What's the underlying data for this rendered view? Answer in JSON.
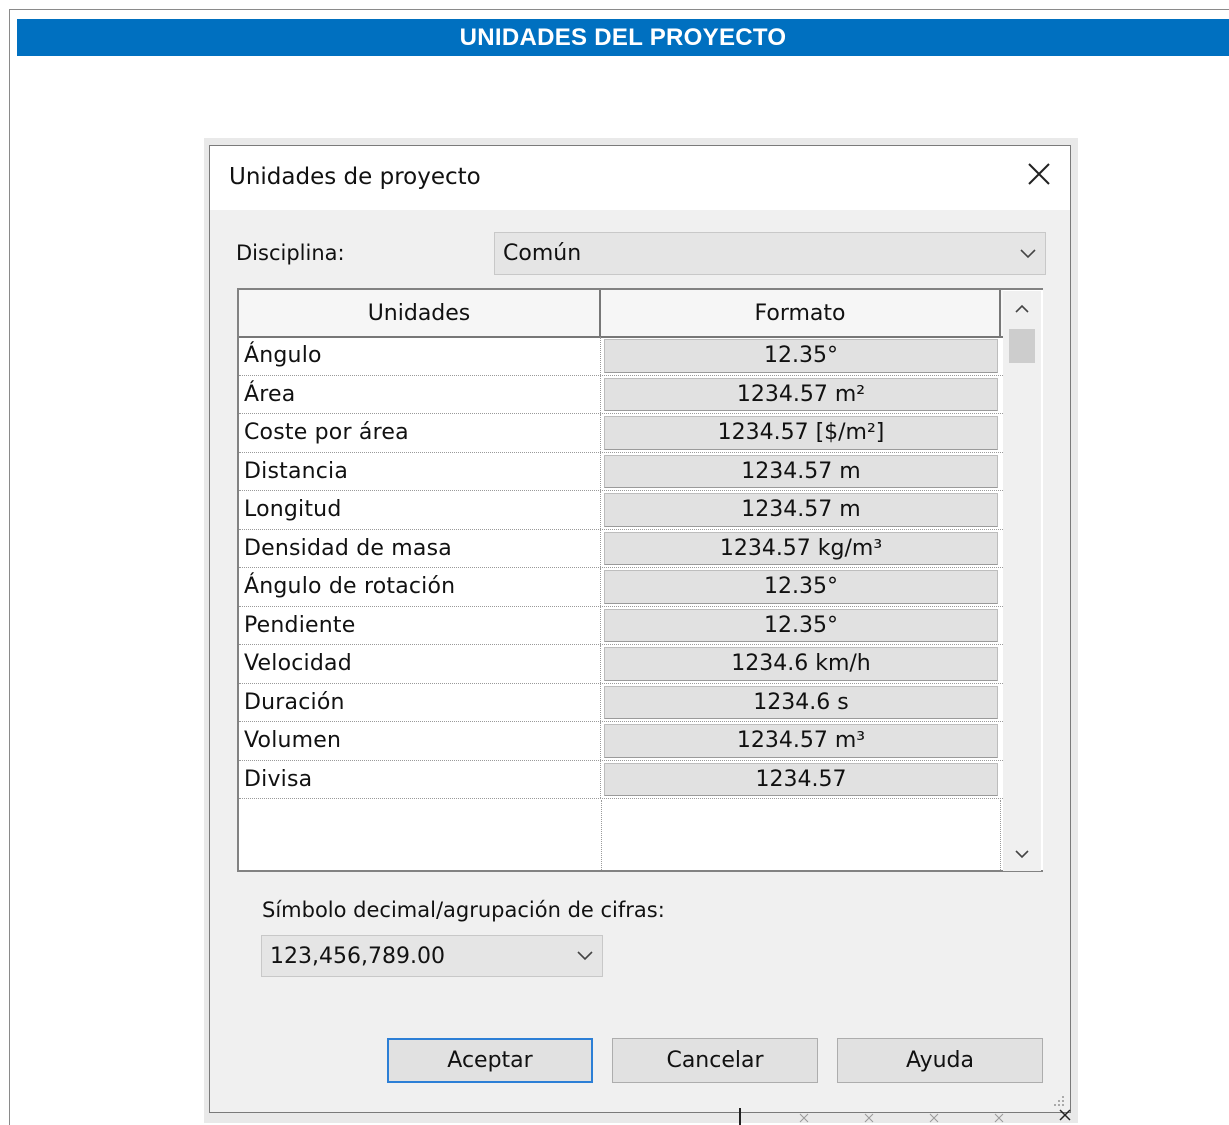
{
  "banner": {
    "title": "UNIDADES DEL PROYECTO"
  },
  "dialog": {
    "title": "Unidades de proyecto",
    "discipline": {
      "label": "Disciplina:",
      "value": "Común"
    },
    "grid": {
      "headers": {
        "units": "Unidades",
        "format": "Formato"
      },
      "rows": [
        {
          "unit": "Ángulo",
          "format": "12.35°"
        },
        {
          "unit": "Área",
          "format": "1234.57 m²"
        },
        {
          "unit": "Coste por área",
          "format": "1234.57 [$/m²]"
        },
        {
          "unit": "Distancia",
          "format": "1234.57 m"
        },
        {
          "unit": "Longitud",
          "format": "1234.57 m"
        },
        {
          "unit": "Densidad de masa",
          "format": "1234.57 kg/m³"
        },
        {
          "unit": "Ángulo de rotación",
          "format": "12.35°"
        },
        {
          "unit": "Pendiente",
          "format": "12.35°"
        },
        {
          "unit": "Velocidad",
          "format": "1234.6 km/h"
        },
        {
          "unit": "Duración",
          "format": "1234.6 s"
        },
        {
          "unit": "Volumen",
          "format": "1234.57 m³"
        },
        {
          "unit": "Divisa",
          "format": "1234.57"
        }
      ]
    },
    "decimal": {
      "label": "Símbolo decimal/agrupación de cifras:",
      "value": "123,456,789.00"
    },
    "buttons": {
      "ok": "Aceptar",
      "cancel": "Cancelar",
      "help": "Ayuda"
    }
  },
  "icons": {
    "close": "close-icon",
    "dropdown": "chevron-down-icon",
    "scroll_up": "chevron-up-icon",
    "scroll_down": "chevron-down-icon"
  },
  "colors": {
    "banner": "#0070c0",
    "default_button_border": "#2c7fd6"
  }
}
